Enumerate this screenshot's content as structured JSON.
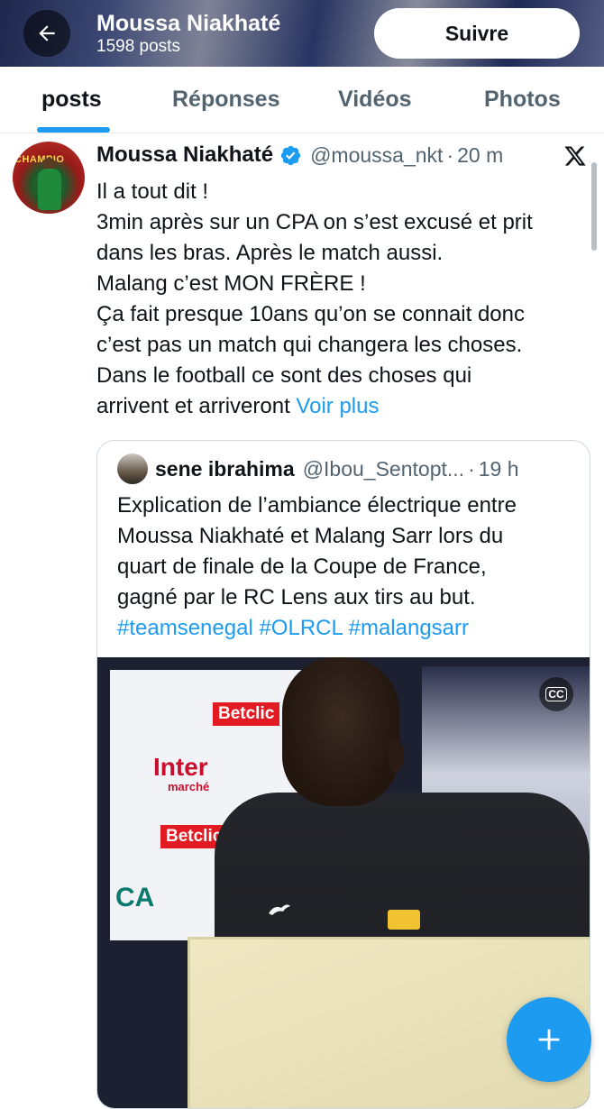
{
  "header": {
    "name": "Moussa Niakhaté",
    "post_count": "1598 posts",
    "follow_label": "Suivre"
  },
  "tabs": [
    {
      "label": "posts",
      "active": true
    },
    {
      "label": "Réponses",
      "active": false
    },
    {
      "label": "Vidéos",
      "active": false
    },
    {
      "label": "Photos",
      "active": false
    }
  ],
  "tweet": {
    "author_name": "Moussa Niakhaté",
    "handle": "@moussa_nkt",
    "separator": "·",
    "time": "20 m",
    "lines": [
      "Il a tout dit !",
      "3min après sur un CPA on s’est excusé et prit",
      "dans les bras. Après le match aussi.",
      "Malang c’est MON FRÈRE !",
      "Ça fait presque 10ans qu’on se connait donc",
      "c’est pas un match qui changera les choses.",
      "Dans le football ce sont des choses qui",
      "arrivent et arriveront"
    ],
    "see_more": "Voir plus"
  },
  "quote": {
    "author_name": "sene ibrahima",
    "handle": "@Ibou_Sentopt...",
    "separator": "·",
    "time": "19 h",
    "lines": [
      "Explication de l’ambiance électrique entre",
      "Moussa Niakhaté et Malang Sarr lors du",
      "quart de finale de la Coupe de France,",
      "gagné par le RC Lens aux tirs au but."
    ],
    "hashtags": [
      "#teamsenegal",
      "#OLRCL",
      "#malangsarr"
    ],
    "media": {
      "caption_button": "CC",
      "brands": [
        "Betclic",
        "Inter",
        "marché",
        "Betclic",
        "CA"
      ]
    }
  },
  "avatar_text": "CHAMPIO",
  "colors": {
    "accent": "#1d9bf0",
    "text": "#0f1419",
    "muted": "#536471"
  }
}
